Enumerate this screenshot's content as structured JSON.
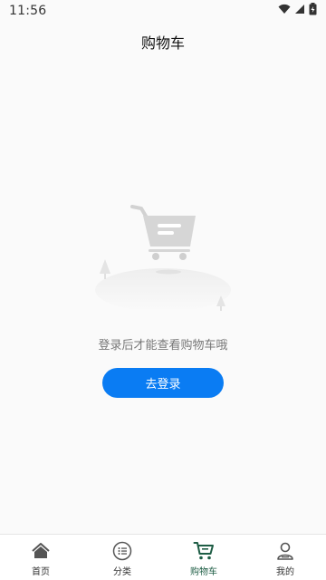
{
  "status_bar": {
    "time": "11:56"
  },
  "header": {
    "title": "购物车"
  },
  "empty_state": {
    "message": "登录后才能查看购物车哦",
    "login_button_label": "去登录"
  },
  "tab_bar": {
    "active_tab": "购物车",
    "active_color": "#1e5d45",
    "items": [
      {
        "label": "首页",
        "icon": "home-icon"
      },
      {
        "label": "分类",
        "icon": "category-icon"
      },
      {
        "label": "购物车",
        "icon": "cart-icon"
      },
      {
        "label": "我的",
        "icon": "profile-icon"
      }
    ]
  },
  "colors": {
    "primary_button": "#0a7cf3",
    "active_tab": "#1e5d45"
  }
}
